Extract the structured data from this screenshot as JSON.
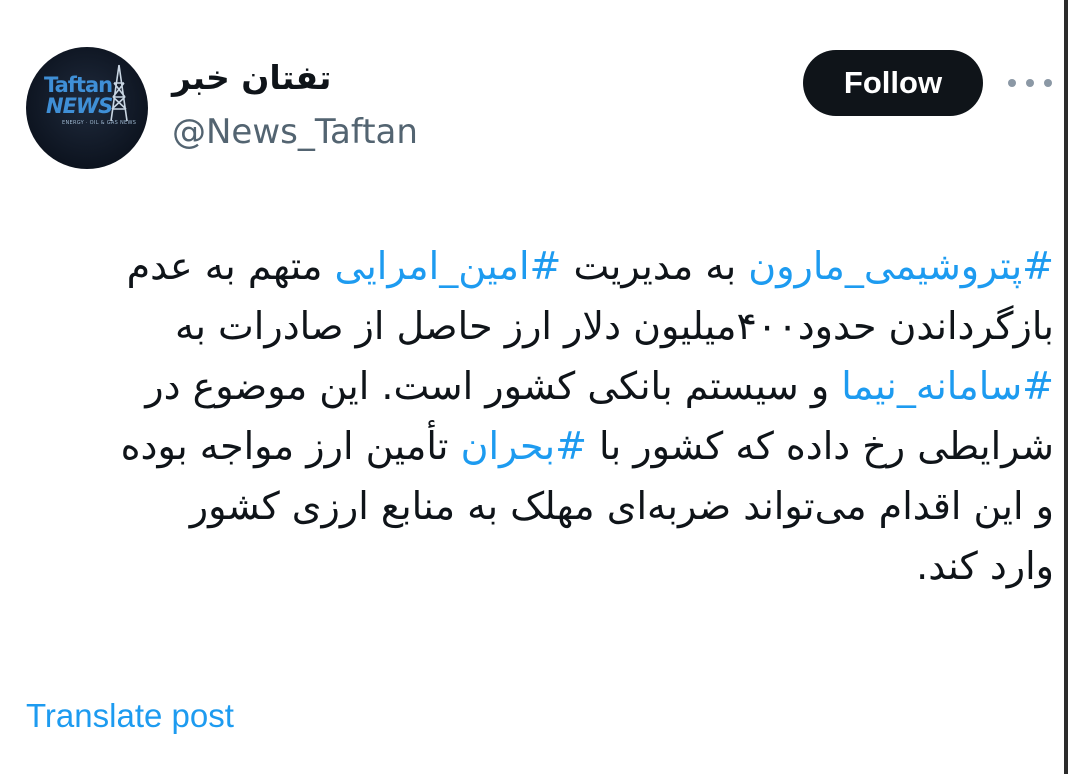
{
  "author": {
    "display_name": "تفتان خبر",
    "handle": "@News_Taftan",
    "avatar_logo_top": "Taftan",
    "avatar_logo_bottom": "NEWS",
    "avatar_logo_tagline": "ENERGY · OIL & GAS NEWS"
  },
  "actions": {
    "follow_label": "Follow",
    "more_icon": "more-horizontal-icon"
  },
  "tweet": {
    "lines": [
      [
        {
          "text": "#پتروشیمی_مارون",
          "hashtag": true
        },
        {
          "text": " به مدیریت ",
          "hashtag": false
        },
        {
          "text": "#امین_امرایی",
          "hashtag": true
        },
        {
          "text": " متهم به عدم",
          "hashtag": false
        }
      ],
      [
        {
          "text": "بازگرداندن حدود۴۰۰میلیون دلار ارز حاصل از صادرات به",
          "hashtag": false
        }
      ],
      [
        {
          "text": "#سامانه_نیما",
          "hashtag": true
        },
        {
          "text": " و سیستم بانکی کشور است. این موضوع در",
          "hashtag": false
        }
      ],
      [
        {
          "text": "شرایطی رخ داده که کشور با ",
          "hashtag": false
        },
        {
          "text": "#بحران",
          "hashtag": true
        },
        {
          "text": " تأمین ارز مواجه بوده",
          "hashtag": false
        }
      ],
      [
        {
          "text": "و این اقدام می‌تواند ضربه‌ای مهلک به منابع ارزی کشور",
          "hashtag": false
        }
      ],
      [
        {
          "text": "وارد کند.",
          "hashtag": false
        }
      ]
    ]
  },
  "translate_label": "Translate post",
  "colors": {
    "link": "#1d9bf0",
    "text": "#0f1419",
    "secondary": "#536471",
    "button_bg": "#0f1419"
  }
}
